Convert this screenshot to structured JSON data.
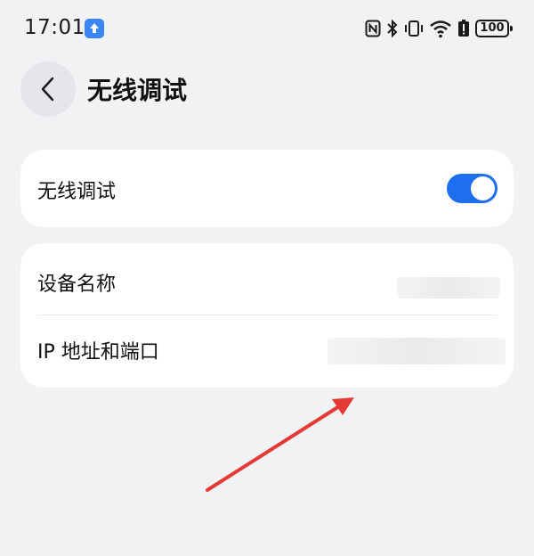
{
  "status_bar": {
    "time": "17:01",
    "battery": "100",
    "icons": [
      "nfc-icon",
      "bluetooth-icon",
      "vibrate-icon",
      "wifi-icon",
      "battery-alert-icon",
      "battery-icon"
    ]
  },
  "header": {
    "title": "无线调试",
    "back_icon": "chevron-left-icon"
  },
  "toggle_card": {
    "label": "无线调试",
    "enabled": true,
    "accent": "#1f6ef0"
  },
  "info_card": {
    "device_name_label": "设备名称",
    "ip_port_label": "IP 地址和端口"
  },
  "annotation": {
    "arrow_color": "#e53935"
  }
}
